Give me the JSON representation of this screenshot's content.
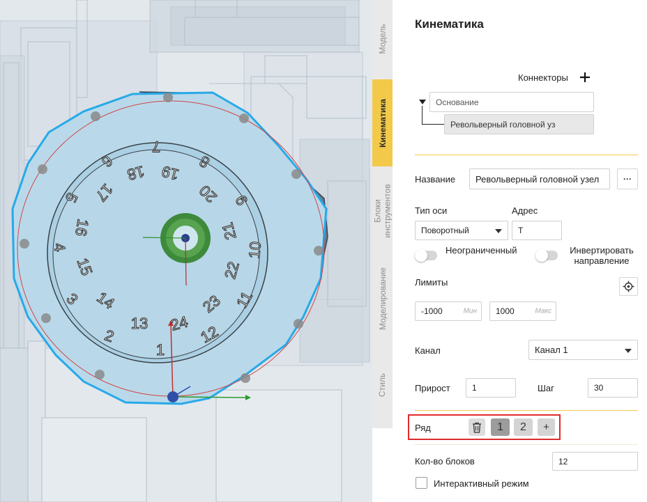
{
  "viewport": {
    "turret_numbers": [
      "1",
      "2",
      "3",
      "4",
      "5",
      "6",
      "7",
      "8",
      "9",
      "10",
      "11",
      "12",
      "13",
      "14",
      "15",
      "16",
      "17",
      "18",
      "19",
      "20",
      "21",
      "22",
      "23",
      "24"
    ]
  },
  "tabs": [
    {
      "label": "Модель",
      "active": false
    },
    {
      "label": "Кинематика",
      "active": true
    },
    {
      "label": "Блоки инструментов",
      "active": false
    },
    {
      "label": "Моделирование",
      "active": false
    },
    {
      "label": "Стиль",
      "active": false
    }
  ],
  "panel": {
    "title": "Кинематика",
    "connectors_label": "Коннекторы",
    "add_icon": "plus-icon",
    "tree": {
      "root": "Основание",
      "child": "Револьверный головной уз"
    },
    "name_label": "Название",
    "name_value": "Револьверный головной узел",
    "more_label": "···",
    "axis_type_label": "Тип оси",
    "axis_type_value": "Поворотный",
    "address_label": "Адрес",
    "address_value": "T",
    "unlimited_label": "Неограниченный",
    "invert_label": "Инвертировать направление",
    "limits_label": "Лимиты",
    "limit_min_value": "-1000",
    "limit_min_unit": "Мин",
    "limit_max_value": "1000",
    "limit_max_unit": "Макс",
    "channel_label": "Канал",
    "channel_value": "Канал 1",
    "increment_label": "Прирост",
    "increment_value": "1",
    "step_label": "Шаг",
    "step_value": "30",
    "row_label": "Ряд",
    "row_chips": [
      "1",
      "2"
    ],
    "row_add": "+",
    "blocks_count_label": "Кол-во блоков",
    "blocks_count_value": "12",
    "interactive_label": "Интерактивный режим"
  },
  "colors": {
    "accent": "#f3c94a",
    "highlight_box": "#e02b2b",
    "turret_fill": "#b9d9ea",
    "turret_outline": "#27a9e8"
  }
}
